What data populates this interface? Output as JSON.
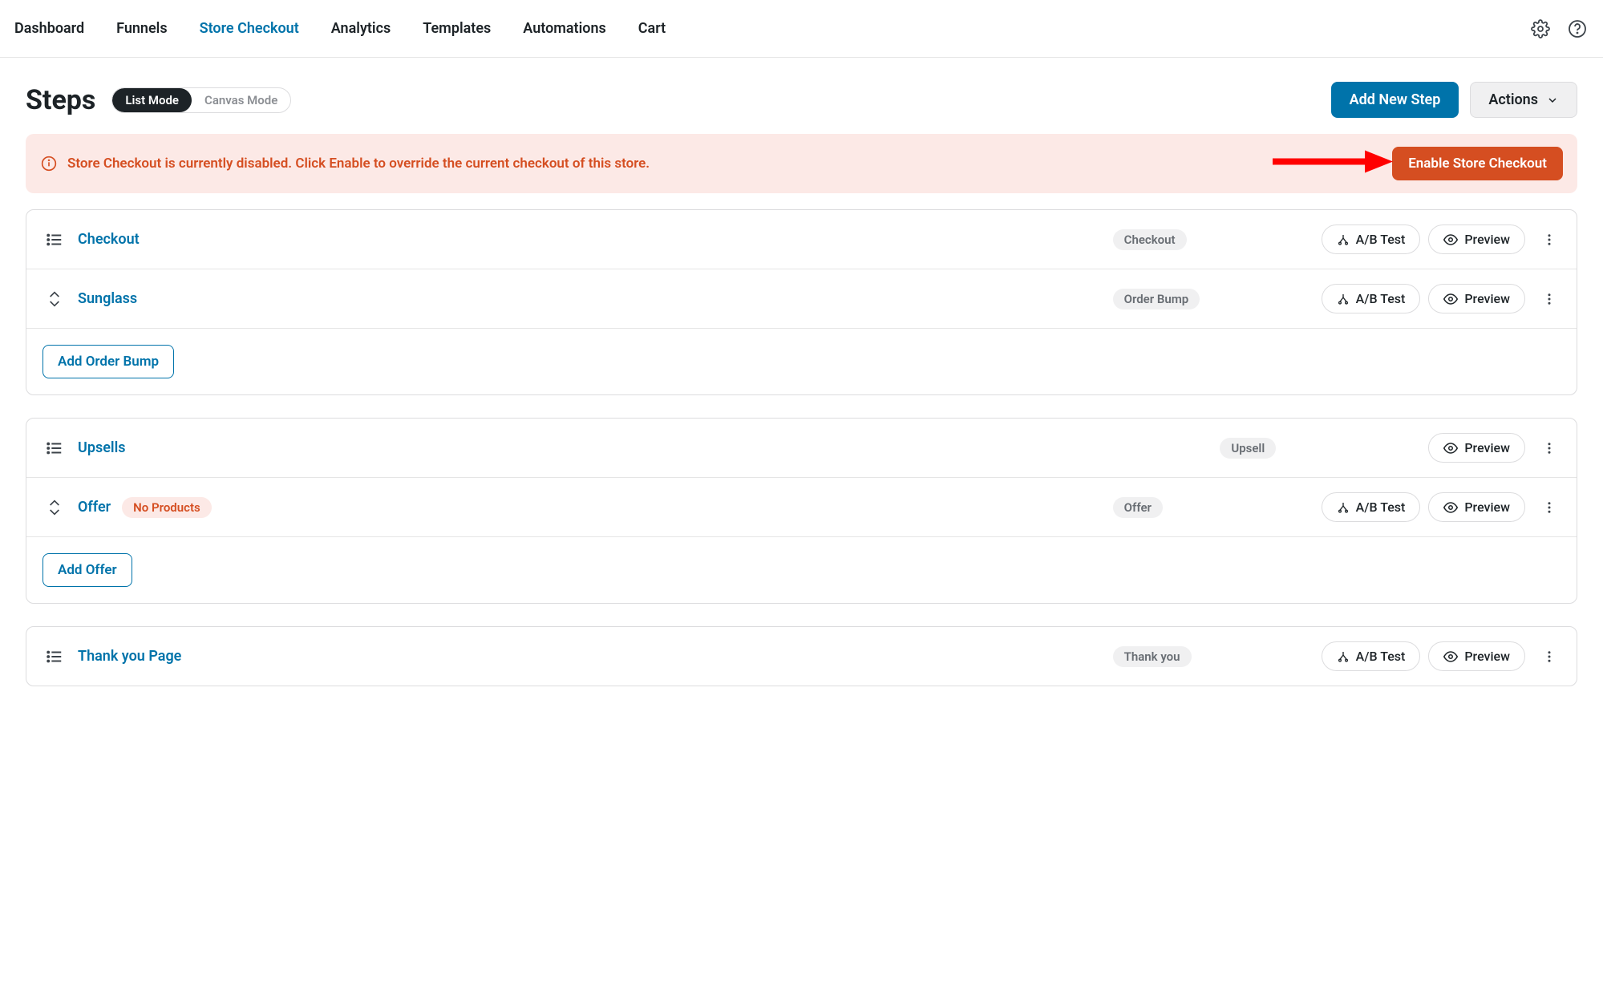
{
  "nav": {
    "items": [
      {
        "label": "Dashboard",
        "active": false
      },
      {
        "label": "Funnels",
        "active": false
      },
      {
        "label": "Store Checkout",
        "active": true
      },
      {
        "label": "Analytics",
        "active": false
      },
      {
        "label": "Templates",
        "active": false
      },
      {
        "label": "Automations",
        "active": false
      },
      {
        "label": "Cart",
        "active": false
      }
    ]
  },
  "header": {
    "title": "Steps",
    "mode_list": "List Mode",
    "mode_canvas": "Canvas Mode",
    "add_step": "Add New Step",
    "actions": "Actions"
  },
  "alert": {
    "text": "Store Checkout is currently disabled. Click Enable to override the current checkout of this store.",
    "button": "Enable Store Checkout"
  },
  "buttons": {
    "ab_test": "A/B Test",
    "preview": "Preview",
    "add_order_bump": "Add Order Bump",
    "add_offer": "Add Offer"
  },
  "groups": [
    {
      "rows": [
        {
          "name": "Checkout",
          "type_label": "Checkout",
          "handle": "list",
          "ab": true,
          "badge": null
        },
        {
          "name": "Sunglass",
          "type_label": "Order Bump",
          "handle": "updown",
          "ab": true,
          "badge": null
        }
      ],
      "add_label_key": "add_order_bump"
    },
    {
      "rows": [
        {
          "name": "Upsells",
          "type_label": "Upsell",
          "handle": "list",
          "ab": false,
          "badge": null
        },
        {
          "name": "Offer",
          "type_label": "Offer",
          "handle": "updown",
          "ab": true,
          "badge": "No Products"
        }
      ],
      "add_label_key": "add_offer"
    },
    {
      "rows": [
        {
          "name": "Thank you Page",
          "type_label": "Thank you",
          "handle": "list",
          "ab": true,
          "badge": null
        }
      ],
      "add_label_key": null
    }
  ]
}
